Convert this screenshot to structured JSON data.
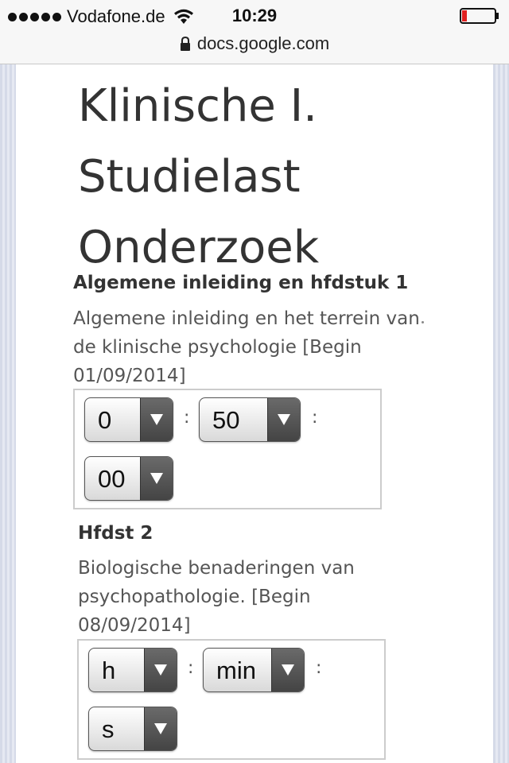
{
  "status_bar": {
    "carrier": "Vodafone.de",
    "time": "10:29",
    "battery_color": "#e02020"
  },
  "browser": {
    "url": "docs.google.com"
  },
  "form": {
    "title_lines": [
      "Klinische I.",
      "Studielast",
      "Onderzoek"
    ],
    "questions": [
      {
        "title": "Algemene inleiding en hfdstuk 1",
        "description_lines": [
          "Algemene inleiding en het terrein van",
          "de klinische psychologie [Begin",
          "01/09/2014]"
        ],
        "hours": "0",
        "minutes": "50",
        "seconds": "00",
        "separator": ":"
      },
      {
        "title": "Hfdst 2",
        "description_lines": [
          "Biologische benaderingen van",
          "psychopathologie. [Begin",
          "08/09/2014]"
        ],
        "hours": "h",
        "minutes": "min",
        "seconds": "s",
        "separator": ":"
      }
    ]
  }
}
